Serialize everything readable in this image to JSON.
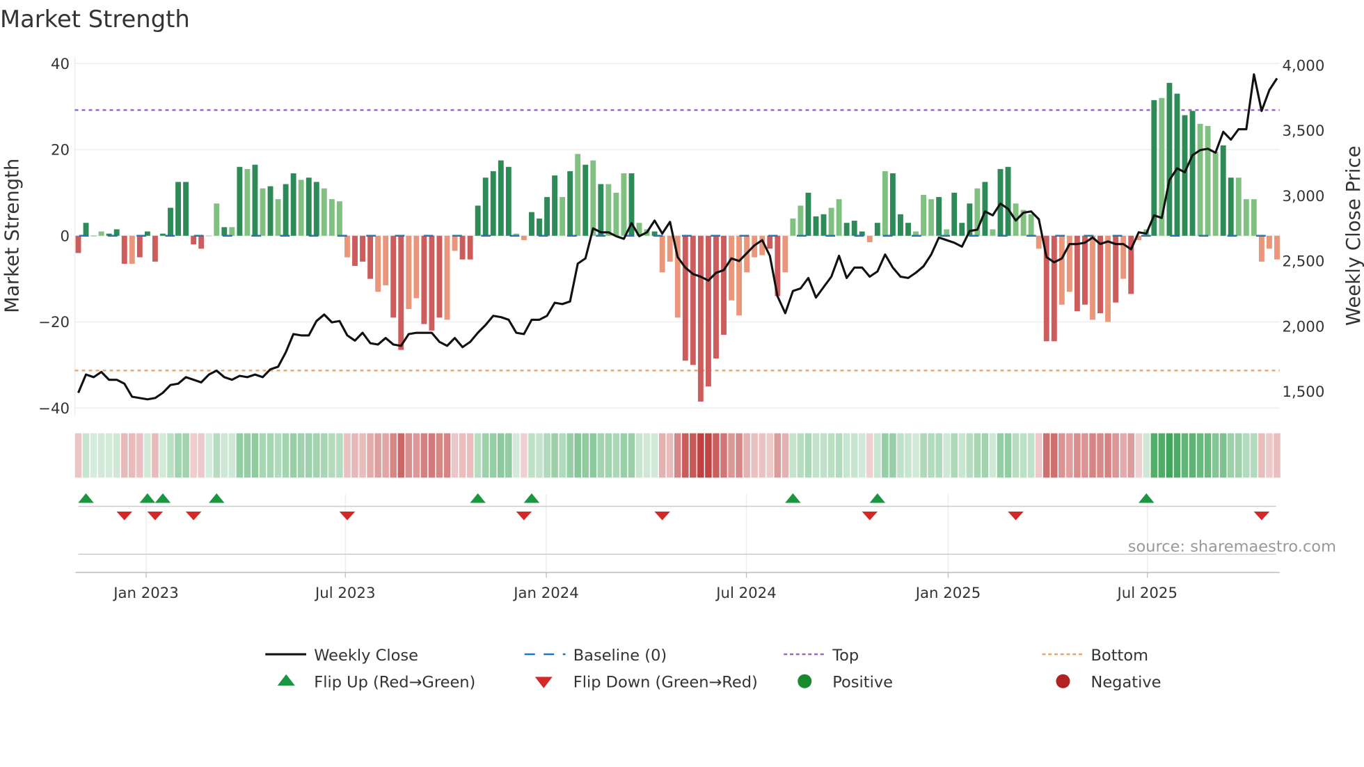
{
  "chart_data": {
    "type": "bar",
    "title": "Market Strength",
    "ylabel": "Market Strength",
    "y2label": "Weekly Close Price",
    "ylim": [
      -42,
      41
    ],
    "y2lim": [
      1370,
      4030
    ],
    "yticks": [
      "40",
      "20",
      "0",
      "−20",
      "−40"
    ],
    "ytick_values": [
      40,
      20,
      0,
      -20,
      -40
    ],
    "y2ticks": [
      "4,000",
      "3,500",
      "3,000",
      "2,500",
      "2,000",
      "1,500"
    ],
    "y2tick_values": [
      4000,
      3500,
      3000,
      2500,
      2000,
      1500
    ],
    "xticks": [
      "Jan 2023",
      "Jul 2023",
      "Jan 2024",
      "Jul 2024",
      "Jan 2025",
      "Jul 2025"
    ],
    "top_level": 29.2,
    "bottom_level": -31.3,
    "strength": [
      -4,
      3,
      0,
      1,
      0.5,
      1.5,
      -6.5,
      -6.5,
      -5,
      1,
      -6,
      0.5,
      6.5,
      12.5,
      12.5,
      -2,
      -3,
      0,
      7.5,
      2,
      2,
      16,
      15.5,
      16.5,
      11,
      11.5,
      8.5,
      12,
      14.5,
      13,
      13.5,
      12.5,
      11,
      8.5,
      8,
      -5,
      -7,
      -6,
      -10,
      -13,
      -11.5,
      -19,
      -26.5,
      -17,
      -14.5,
      -20.5,
      -22,
      -19,
      -19.5,
      -3.5,
      -5.5,
      -5.5,
      7,
      13.5,
      15,
      17.5,
      16,
      0.5,
      -1,
      5.5,
      4,
      9,
      14,
      9,
      15,
      19,
      16.5,
      17.5,
      12,
      12,
      10,
      14.5,
      14.5,
      3,
      1.5,
      1,
      -8.5,
      -6,
      -19,
      -29,
      -30,
      -38.5,
      -35,
      -28.5,
      -23,
      -15,
      -18.5,
      -8.5,
      -5,
      -4.5,
      -3,
      -14,
      -8.5,
      4,
      7,
      10,
      4.5,
      5,
      6.5,
      8.5,
      3,
      3.5,
      1,
      -1.5,
      3,
      15,
      14.5,
      5,
      3,
      1,
      9.5,
      8.5,
      9,
      1.5,
      10,
      3,
      7.5,
      11,
      12.5,
      1.5,
      15.5,
      16,
      7.5,
      6,
      5,
      -3,
      -24.5,
      -24.5,
      -16,
      -13,
      -17.5,
      -16,
      -19.5,
      -18,
      -20,
      -15.5,
      -10,
      -13.5,
      -1,
      1.5,
      31.5,
      32,
      35.5,
      33,
      28,
      29,
      26,
      25.5,
      19.5,
      21,
      13.5,
      13.5,
      8.5,
      8.5,
      -6,
      -3,
      -5.5
    ],
    "shade": "dddldddldddddddddlldldldldlddlddlllldddllddlldddlldddddddllddddldldldllldlldlllddddddlllllddllldddlldddldldddllldldddldlddllllddllddldldldlldlddddlllddllllllllldld",
    "weekly_close": [
      1490,
      1630,
      1610,
      1650,
      1590,
      1590,
      1560,
      1460,
      1450,
      1440,
      1450,
      1490,
      1550,
      1560,
      1610,
      1590,
      1570,
      1630,
      1660,
      1610,
      1590,
      1620,
      1610,
      1630,
      1610,
      1670,
      1690,
      1800,
      1940,
      1930,
      1930,
      2040,
      2090,
      2030,
      2040,
      1930,
      1890,
      1950,
      1870,
      1860,
      1910,
      1860,
      1850,
      1940,
      1950,
      1950,
      1950,
      1880,
      1850,
      1910,
      1840,
      1880,
      1950,
      2010,
      2080,
      2070,
      2050,
      1950,
      1940,
      2050,
      2050,
      2080,
      2180,
      2170,
      2190,
      2480,
      2520,
      2750,
      2720,
      2720,
      2690,
      2670,
      2790,
      2690,
      2720,
      2810,
      2710,
      2800,
      2530,
      2450,
      2400,
      2380,
      2350,
      2410,
      2430,
      2520,
      2500,
      2560,
      2620,
      2660,
      2540,
      2230,
      2100,
      2270,
      2290,
      2370,
      2220,
      2300,
      2380,
      2540,
      2370,
      2450,
      2450,
      2380,
      2420,
      2550,
      2450,
      2380,
      2370,
      2410,
      2460,
      2550,
      2680,
      2660,
      2640,
      2610,
      2730,
      2740,
      2880,
      2850,
      2940,
      2900,
      2810,
      2870,
      2880,
      2820,
      2530,
      2490,
      2520,
      2630,
      2630,
      2640,
      2680,
      2630,
      2650,
      2630,
      2630,
      2590,
      2720,
      2710,
      2850,
      2830,
      3120,
      3210,
      3180,
      3310,
      3350,
      3360,
      3330,
      3490,
      3430,
      3510,
      3510,
      3930,
      3650,
      3810,
      3900
    ],
    "flip_up_weeks": [
      1,
      9,
      11,
      18,
      52,
      59,
      93,
      104,
      139
    ],
    "flip_down_weeks": [
      6,
      10,
      15,
      35,
      58,
      76,
      103,
      122,
      154
    ],
    "legend": {
      "position": "bottom",
      "items": [
        {
          "label": "Weekly Close",
          "kind": "line",
          "color": "#111111"
        },
        {
          "label": "Baseline (0)",
          "kind": "dash",
          "color": "#1f77b4"
        },
        {
          "label": "Top",
          "kind": "dot",
          "color": "#9966cc"
        },
        {
          "label": "Bottom",
          "kind": "dot",
          "color": "#f4a460"
        },
        {
          "label": "Flip Up (Red→Green)",
          "kind": "up",
          "color": "#1a9641"
        },
        {
          "label": "Flip Down (Green→Red)",
          "kind": "down",
          "color": "#d62728"
        },
        {
          "label": "Positive",
          "kind": "circle",
          "color": "#1a8a2e"
        },
        {
          "label": "Negative",
          "kind": "circle",
          "color": "#b22222"
        }
      ]
    },
    "colors": {
      "pos_strong": "#2e8b57",
      "pos_weak": "#80c080",
      "neg_strong": "#cd5c5c",
      "neg_weak": "#e9967a",
      "baseline": "#1f77b4",
      "top": "#9966cc",
      "bottom": "#f4a460"
    },
    "source": "source: sharemaestro.com"
  }
}
